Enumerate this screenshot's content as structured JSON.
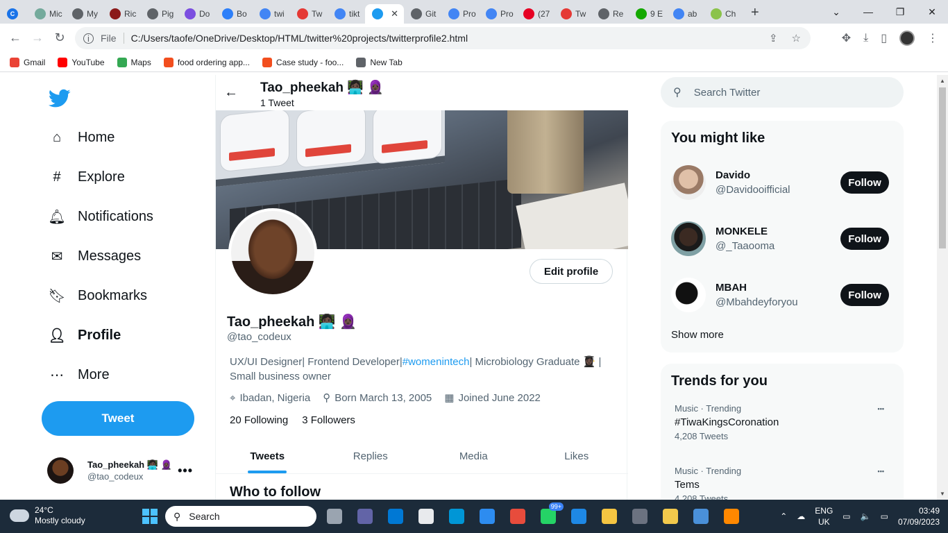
{
  "browser": {
    "tabs": [
      {
        "label": "Mic",
        "color": "#74aa9c"
      },
      {
        "label": "My",
        "color": "#5f6368"
      },
      {
        "label": "Ric",
        "color": "#8b1a1a"
      },
      {
        "label": "Pig",
        "color": "#5f6368"
      },
      {
        "label": "Do",
        "color": "#7b4ee0"
      },
      {
        "label": "Bo",
        "color": "#2d7ff9"
      },
      {
        "label": "twi",
        "color": "#4285f4"
      },
      {
        "label": "Tw",
        "color": "#e53935"
      },
      {
        "label": "tikt",
        "color": "#4285f4"
      },
      {
        "label": "",
        "color": "#1d9bf0",
        "active": true
      },
      {
        "label": "Git",
        "color": "#5f6368"
      },
      {
        "label": "Pro",
        "color": "#4285f4"
      },
      {
        "label": "Pro",
        "color": "#4285f4"
      },
      {
        "label": "(27",
        "color": "#e60023"
      },
      {
        "label": "Tw",
        "color": "#e53935"
      },
      {
        "label": "Re",
        "color": "#5f6368"
      },
      {
        "label": "9 E",
        "color": "#14a800"
      },
      {
        "label": "ab",
        "color": "#4285f4"
      },
      {
        "label": "Ch",
        "color": "#8bc34a"
      }
    ],
    "address_prefix": "File",
    "address": "C:/Users/taofe/OneDrive/Desktop/HTML/twitter%20projects/twitterprofile2.html",
    "bookmarks": [
      {
        "label": "Gmail",
        "color": "#ea4335"
      },
      {
        "label": "YouTube",
        "color": "#ff0000"
      },
      {
        "label": "Maps",
        "color": "#34a853"
      },
      {
        "label": "food ordering app...",
        "color": "#f24e1e"
      },
      {
        "label": "Case study - foo...",
        "color": "#f24e1e"
      },
      {
        "label": "New Tab",
        "color": "#5f6368"
      }
    ]
  },
  "nav": {
    "items": [
      {
        "label": "Home",
        "icon": "home-icon"
      },
      {
        "label": "Explore",
        "icon": "hashtag-icon"
      },
      {
        "label": "Notifications",
        "icon": "bell-icon"
      },
      {
        "label": "Messages",
        "icon": "mail-icon"
      },
      {
        "label": "Bookmarks",
        "icon": "bookmark-icon"
      },
      {
        "label": "Profile",
        "icon": "user-icon"
      },
      {
        "label": "More",
        "icon": "more-icon"
      }
    ],
    "tweet_button": "Tweet",
    "account": {
      "name": "Tao_pheekah 👩🏿‍💻 🧕🏿",
      "handle": "@tao_codeux"
    }
  },
  "profile": {
    "header_name": "Tao_pheekah 👩🏿‍💻 🧕🏿",
    "tweet_count": "1 Tweet",
    "edit_button": "Edit profile",
    "name": "Tao_pheekah 👩🏿‍💻 🧕🏿",
    "handle": "@tao_codeux",
    "bio_before": "UX/UI Designer| Frontend Developer|",
    "bio_tag": "#womenintech",
    "bio_after": "| Microbiology Graduate 👩🏿‍🎓 | Small business owner",
    "location": "Ibadan, Nigeria",
    "born": "Born March 13, 2005",
    "joined": "Joined June 2022",
    "following_count": "20",
    "following_label": "Following",
    "followers_count": "3",
    "followers_label": "Followers",
    "tabs": [
      "Tweets",
      "Replies",
      "Media",
      "Likes"
    ],
    "who_to_follow": "Who to follow"
  },
  "sidebar": {
    "search_placeholder": "Search Twitter",
    "might_like_title": "You might like",
    "suggestions": [
      {
        "name": "Davido",
        "handle": "@Davidooifficial",
        "button": "Follow"
      },
      {
        "name": "MONKELE",
        "handle": "@_Taaooma",
        "button": "Follow"
      },
      {
        "name": "MBAH",
        "handle": "@Mbahdeyforyou",
        "button": "Follow"
      }
    ],
    "show_more": "Show more",
    "trends_title": "Trends for you",
    "trends": [
      {
        "context": "Music · Trending",
        "title": "#TiwaKingsCoronation",
        "count": "4,208 Tweets"
      },
      {
        "context": "Music · Trending",
        "title": "Tems",
        "count": "4,208 Tweets"
      }
    ]
  },
  "taskbar": {
    "temperature": "24°C",
    "weather": "Mostly cloudy",
    "search": "Search",
    "whatsapp_badge": "99+",
    "lang_top": "ENG",
    "lang_bottom": "UK",
    "time": "03:49",
    "date": "07/09/2023"
  }
}
